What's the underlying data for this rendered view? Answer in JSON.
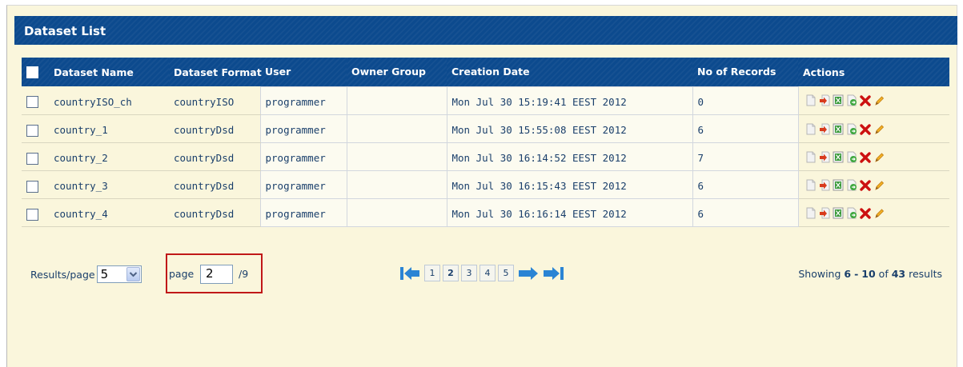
{
  "panel": {
    "title": "Dataset List"
  },
  "columns": [
    "Dataset Name",
    "Dataset Format",
    "User",
    "Owner Group",
    "Creation Date",
    "No of Records",
    "Actions"
  ],
  "rows": [
    {
      "name": "countryISO_ch",
      "format": "countryISO",
      "user": "programmer",
      "group": "",
      "date": "Mon Jul 30 15:19:41 EEST 2012",
      "records": "0"
    },
    {
      "name": "country_1",
      "format": "countryDsd",
      "user": "programmer",
      "group": "",
      "date": "Mon Jul 30 15:55:08 EEST 2012",
      "records": "6"
    },
    {
      "name": "country_2",
      "format": "countryDsd",
      "user": "programmer",
      "group": "",
      "date": "Mon Jul 30 16:14:52 EEST 2012",
      "records": "7"
    },
    {
      "name": "country_3",
      "format": "countryDsd",
      "user": "programmer",
      "group": "",
      "date": "Mon Jul 30 16:15:43 EEST 2012",
      "records": "6"
    },
    {
      "name": "country_4",
      "format": "countryDsd",
      "user": "programmer",
      "group": "",
      "date": "Mon Jul 30 16:16:14 EEST 2012",
      "records": "6"
    }
  ],
  "row_action_icons": [
    "view-document-icon",
    "export-icon",
    "excel-icon",
    "go-icon",
    "delete-icon",
    "edit-icon"
  ],
  "footer": {
    "results_label": "Results/page",
    "results_per_page": "5",
    "page_label": "page",
    "page_value": "2",
    "page_total": "/9",
    "pages": [
      "1",
      "2",
      "3",
      "4",
      "5"
    ],
    "current_page": "2",
    "showing_prefix": "Showing",
    "showing_from": "6",
    "showing_sep": "-",
    "showing_to": "10",
    "showing_of": "of",
    "showing_total": "43",
    "showing_suffix": "results"
  },
  "colors": {
    "header_blue": "#0c4a8e",
    "panel_bg": "#faf6dc",
    "highlight_red": "#c01818",
    "delete_red": "#cc1010"
  }
}
